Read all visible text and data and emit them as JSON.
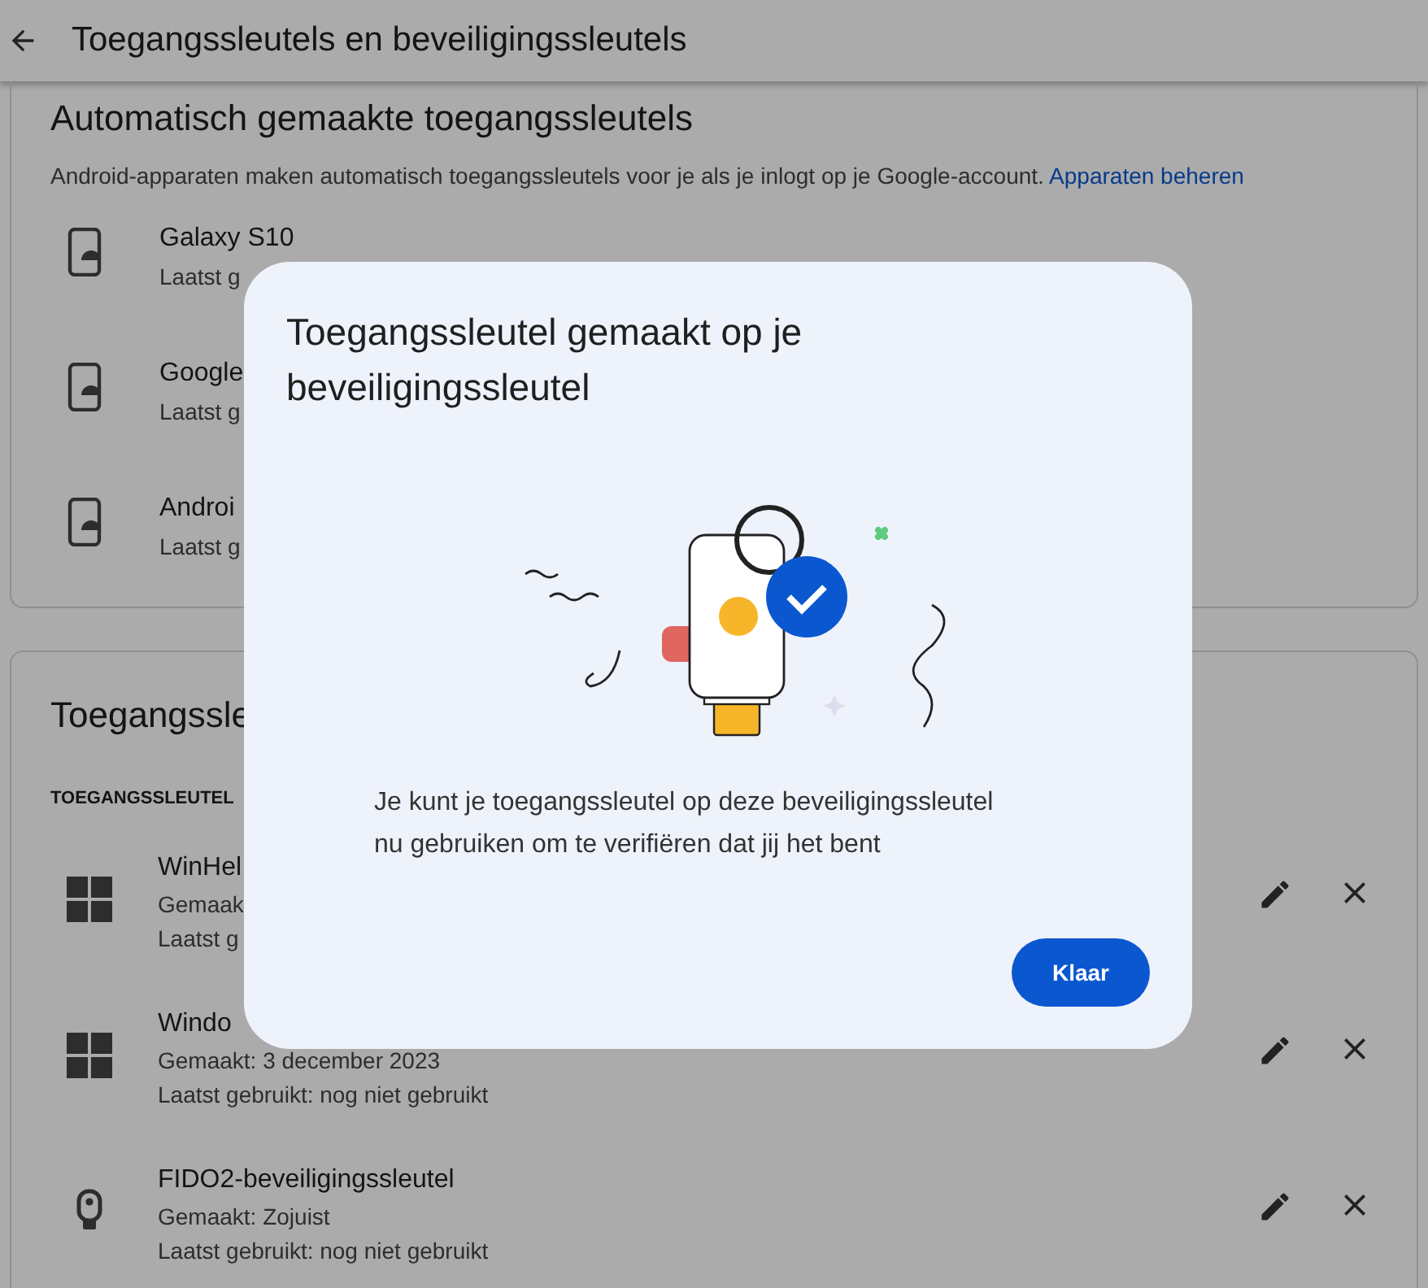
{
  "header": {
    "title": "Toegangssleutels en beveiligingssleutels"
  },
  "auto_section": {
    "title": "Automatisch gemaakte toegangssleutels",
    "description": "Android-apparaten maken automatisch toegangssleutels voor je als je inlogt op je Google-account.",
    "link": "Apparaten beheren",
    "devices": [
      {
        "name": "Galaxy S10",
        "detail": "Laatst g"
      },
      {
        "name": "Google",
        "detail": "Laatst g"
      },
      {
        "name": "Androi",
        "detail": "Laatst g"
      }
    ]
  },
  "keys_section": {
    "title": "Toegangssle",
    "label": "TOEGANGSSLEUTEL",
    "keys": [
      {
        "kind": "windows",
        "name": "WinHel",
        "created": "Gemaak",
        "last_used": "Laatst g"
      },
      {
        "kind": "windows",
        "name": "Windo",
        "created": "Gemaakt: 3 december 2023",
        "last_used": "Laatst gebruikt: nog niet gebruikt"
      },
      {
        "kind": "security-key",
        "name": "FIDO2-beveiligingssleutel",
        "created": "Gemaakt: Zojuist",
        "last_used": "Laatst gebruikt: nog niet gebruikt"
      }
    ]
  },
  "dialog": {
    "title": "Toegangssleutel gemaakt op je beveiligingssleutel",
    "body": "Je kunt je toegangssleutel op deze beveiligingssleutel nu gebruiken om te verifiëren dat jij het bent",
    "button": "Klaar"
  }
}
